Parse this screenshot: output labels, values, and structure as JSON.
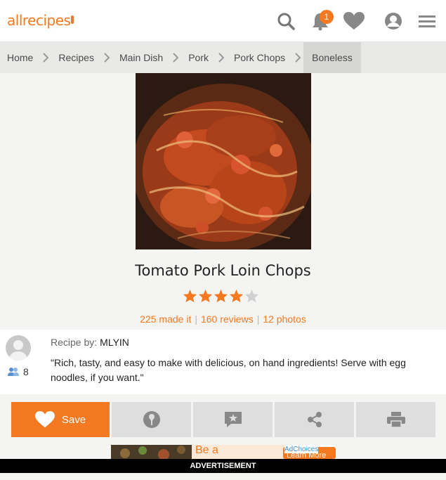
{
  "header": {
    "logo": "allrecipes",
    "notifications_count": "1",
    "icons": [
      "search-icon",
      "notification-bell-icon",
      "heart-icon",
      "user-icon",
      "menu-icon"
    ],
    "accent_color": "#f47920"
  },
  "breadcrumb": [
    "Home",
    "Recipes",
    "Main Dish",
    "Pork",
    "Pork Chops",
    "Boneless"
  ],
  "recipe": {
    "title": "Tomato Pork Loin Chops",
    "rating_value": 4,
    "rating_max": 5,
    "made_it": "225 made it",
    "reviews": "160 reviews",
    "photos": "12 photos"
  },
  "author": {
    "label": "Recipe by:",
    "name": "MLYIN",
    "followers": "8",
    "description": "\"Rich, tasty, and easy to make with delicious, on hand ingredients! Serve with egg noodles, if you want.\""
  },
  "actions": {
    "save_label": "Save",
    "icons": [
      "heart-icon",
      "pin-icon",
      "review-icon",
      "share-icon",
      "print-icon"
    ]
  },
  "ad": {
    "text_fragment": "Be a",
    "adchoices": "AdChoices",
    "learn_more": "Learn More",
    "label": "ADVERTISEMENT"
  }
}
